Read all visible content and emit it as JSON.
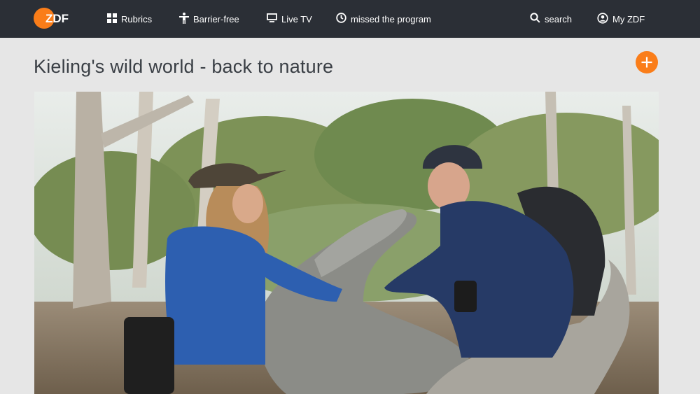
{
  "header": {
    "logo_text": "ZDF",
    "nav": [
      {
        "label": "Rubrics",
        "icon": "grid-icon"
      },
      {
        "label": "Barrier-free",
        "icon": "accessibility-icon"
      },
      {
        "label": "Live TV",
        "icon": "tv-icon"
      },
      {
        "label": "missed the program",
        "icon": "clock-icon"
      }
    ],
    "search_label": "search",
    "account_label": "My ZDF"
  },
  "main": {
    "title": "Kieling's wild world - back to nature",
    "add_button_icon": "plus-icon",
    "hero_image": "two people in outdoor jackets kneeling beside a weathered log in a eucalyptus forest"
  },
  "colors": {
    "header_bg": "#2b2f36",
    "page_bg": "#e6e6e6",
    "accent": "#fa7d19",
    "title_text": "#3a3f45"
  }
}
